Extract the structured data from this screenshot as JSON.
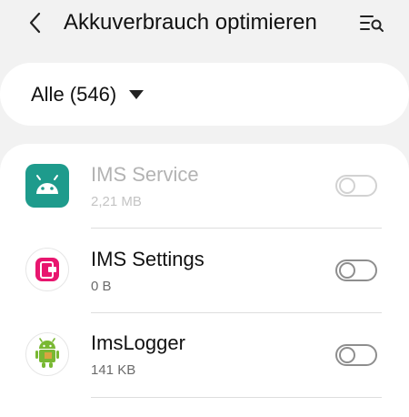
{
  "header": {
    "title": "Akkuverbrauch optimieren",
    "back_icon": "back-arrow-icon",
    "filter_search_icon": "filter-search-icon"
  },
  "filter": {
    "selected": "Alle (546)",
    "icon": "dropdown-caret-icon"
  },
  "apps": [
    {
      "name": "IMS Service",
      "size": "2,21 MB",
      "enabled": false,
      "optimize_on": false,
      "icon": "android-icon",
      "icon_color": "#1e9b8c"
    },
    {
      "name": "IMS Settings",
      "size": "0 B",
      "enabled": true,
      "optimize_on": false,
      "icon": "ims-settings-icon",
      "icon_color": "#e8166f"
    },
    {
      "name": "ImsLogger",
      "size": "141 KB",
      "enabled": true,
      "optimize_on": false,
      "icon": "android-package-icon",
      "icon_color": "#79b833"
    }
  ]
}
